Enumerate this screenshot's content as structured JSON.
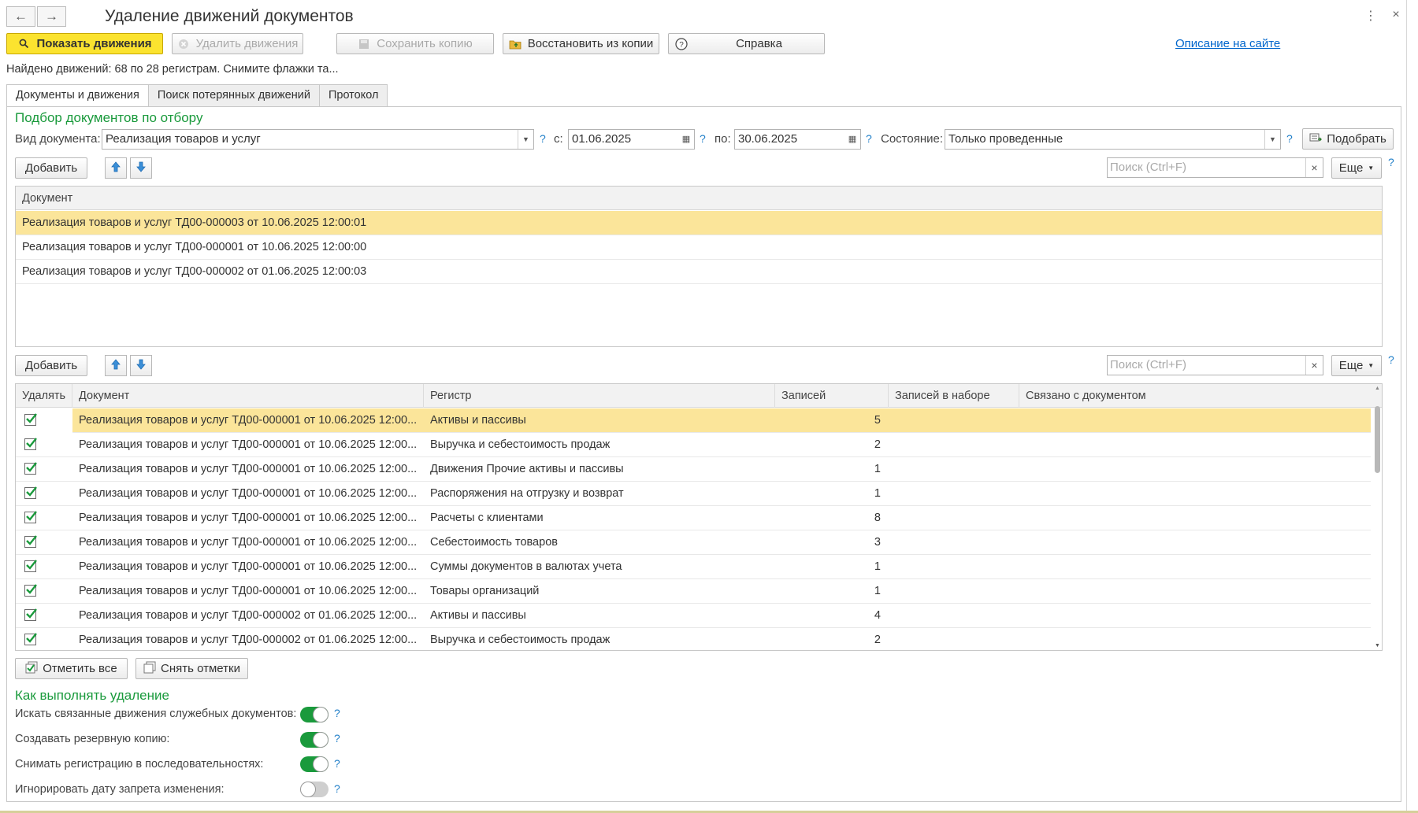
{
  "window": {
    "title": "Удаление движений документов",
    "more_icon": "⋮",
    "close_icon": "×"
  },
  "toolbar": {
    "show": "Показать движения",
    "delete": "Удалить движения",
    "save_copy": "Сохранить копию",
    "restore": "Восстановить из копии",
    "help": "Справка",
    "site_link": "Описание на сайте"
  },
  "info_text": "Найдено движений: 68 по 28 регистрам. Снимите флажки та...",
  "tabs": [
    "Документы и движения",
    "Поиск потерянных движений",
    "Протокол"
  ],
  "filter": {
    "group_title": "Подбор документов по отбору",
    "doc_type_label": "Вид документа:",
    "doc_type_value": "Реализация товаров и услуг",
    "from_label": "с:",
    "from_value": "01.06.2025",
    "to_label": "по:",
    "to_value": "30.06.2025",
    "state_label": "Состояние:",
    "state_value": "Только проведенные",
    "pick_button": "Подобрать",
    "help": "?"
  },
  "docs_toolbar": {
    "add": "Добавить",
    "search_placeholder": "Поиск (Ctrl+F)",
    "more": "Еще"
  },
  "docs_table": {
    "header": "Документ",
    "rows": [
      "Реализация товаров и услуг ТД00-000003 от 10.06.2025 12:00:01",
      "Реализация товаров и услуг ТД00-000001 от 10.06.2025 12:00:00",
      "Реализация товаров и услуг ТД00-000002 от 01.06.2025 12:00:03"
    ]
  },
  "moves_toolbar": {
    "add": "Добавить",
    "search_placeholder": "Поиск (Ctrl+F)",
    "more": "Еще"
  },
  "moves_table": {
    "headers": [
      "Удалять",
      "Документ",
      "Регистр",
      "Записей",
      "Записей в наборе",
      "Связано с документом"
    ],
    "rows": [
      {
        "doc": "Реализация товаров и услуг ТД00-000001 от 10.06.2025 12:00...",
        "reg": "Активы и пассивы",
        "count": "5"
      },
      {
        "doc": "Реализация товаров и услуг ТД00-000001 от 10.06.2025 12:00...",
        "reg": "Выручка и себестоимость продаж",
        "count": "2"
      },
      {
        "doc": "Реализация товаров и услуг ТД00-000001 от 10.06.2025 12:00...",
        "reg": "Движения Прочие активы и пассивы",
        "count": "1"
      },
      {
        "doc": "Реализация товаров и услуг ТД00-000001 от 10.06.2025 12:00...",
        "reg": "Распоряжения на отгрузку и возврат",
        "count": "1"
      },
      {
        "doc": "Реализация товаров и услуг ТД00-000001 от 10.06.2025 12:00...",
        "reg": "Расчеты с клиентами",
        "count": "8"
      },
      {
        "doc": "Реализация товаров и услуг ТД00-000001 от 10.06.2025 12:00...",
        "reg": "Себестоимость товаров",
        "count": "3"
      },
      {
        "doc": "Реализация товаров и услуг ТД00-000001 от 10.06.2025 12:00...",
        "reg": "Суммы документов в валютах учета",
        "count": "1"
      },
      {
        "doc": "Реализация товаров и услуг ТД00-000001 от 10.06.2025 12:00...",
        "reg": "Товары организаций",
        "count": "1"
      },
      {
        "doc": "Реализация товаров и услуг ТД00-000002 от 01.06.2025 12:00...",
        "reg": "Активы и пассивы",
        "count": "4"
      },
      {
        "doc": "Реализация товаров и услуг ТД00-000002 от 01.06.2025 12:00...",
        "reg": "Выручка и себестоимость продаж",
        "count": "2"
      }
    ]
  },
  "mark_buttons": {
    "check_all": "Отметить все",
    "uncheck_all": "Снять отметки"
  },
  "options": {
    "group_title": "Как выполнять удаление",
    "items": [
      {
        "label": "Искать связанные движения служебных документов:",
        "state": "on"
      },
      {
        "label": "Создавать резервную копию:",
        "state": "on"
      },
      {
        "label": "Снимать регистрацию в последовательностях:",
        "state": "on"
      },
      {
        "label": "Игнорировать дату запрета изменения:",
        "state": "off"
      }
    ]
  },
  "colors": {
    "accent_green": "#1a9a3c",
    "primary_button": "#fbe32f",
    "selected_row": "#fbe59a",
    "link": "#0066cc"
  }
}
